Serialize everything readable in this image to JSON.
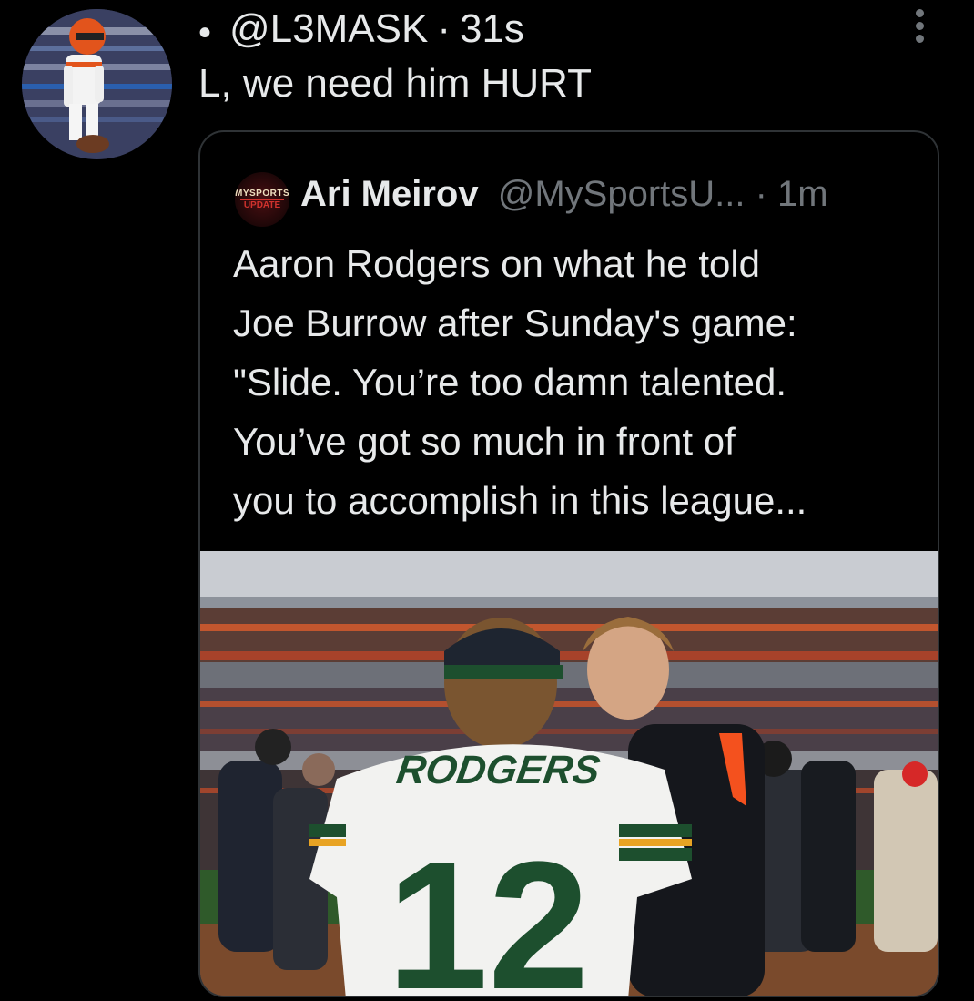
{
  "tweet": {
    "bullet": "•",
    "handle": "@L3MASK",
    "separator": "·",
    "time": "31s",
    "text": "L, we need him HURT"
  },
  "quoted_tweet": {
    "logo": {
      "line1": "MYSPORTS",
      "line2": "UPDATE"
    },
    "display_name": "Ari Meirov",
    "handle": "@MySportsU...",
    "time": "· 1m",
    "lines": [
      "Aaron Rodgers on what he told",
      "Joe Burrow after Sunday's game:",
      "\"Slide. You’re too damn talented.",
      "You’ve got so much in front of",
      "you to accomplish in this league..."
    ],
    "photo": {
      "jersey_name": "RODGERS",
      "jersey_number": "12"
    }
  },
  "icons": {
    "more": "more-vertical-icon"
  },
  "colors": {
    "background": "#000000",
    "text": "#e7e9ea",
    "muted": "#71767b",
    "border": "#2f3336",
    "packers_green": "#1d4f2e",
    "packers_gold": "#e8a323",
    "bengals_orange": "#f4511e"
  }
}
